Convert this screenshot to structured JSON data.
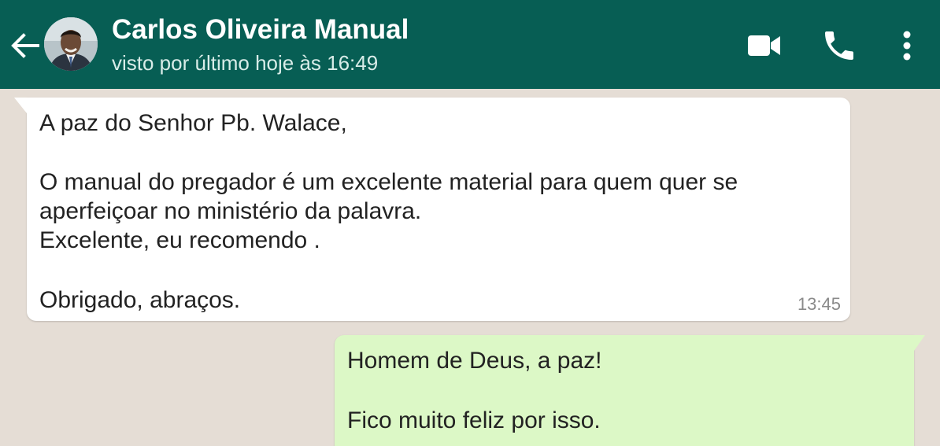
{
  "header": {
    "contact_name": "Carlos Oliveira Manual",
    "status": "visto por último hoje às 16:49",
    "icons": {
      "back": "arrow-left-icon",
      "video": "video-camera-icon",
      "call": "phone-icon",
      "menu": "more-vertical-icon"
    },
    "colors": {
      "bar": "#075e54",
      "text": "#ffffff"
    }
  },
  "messages": [
    {
      "direction": "incoming",
      "lines": [
        "A paz do Senhor Pb. Walace,",
        "",
        "O manual do pregador é um excelente material para quem quer  se",
        "aperfeiçoar no ministério da palavra.",
        "Excelente, eu recomendo .",
        "",
        "Obrigado, abraços."
      ],
      "time": "13:45",
      "color": "#ffffff"
    },
    {
      "direction": "outgoing",
      "lines": [
        "Homem de Deus, a paz!",
        "",
        "Fico muito feliz por isso."
      ],
      "color": "#dcf8c6"
    }
  ],
  "chat": {
    "background": "#e5ddd5"
  }
}
